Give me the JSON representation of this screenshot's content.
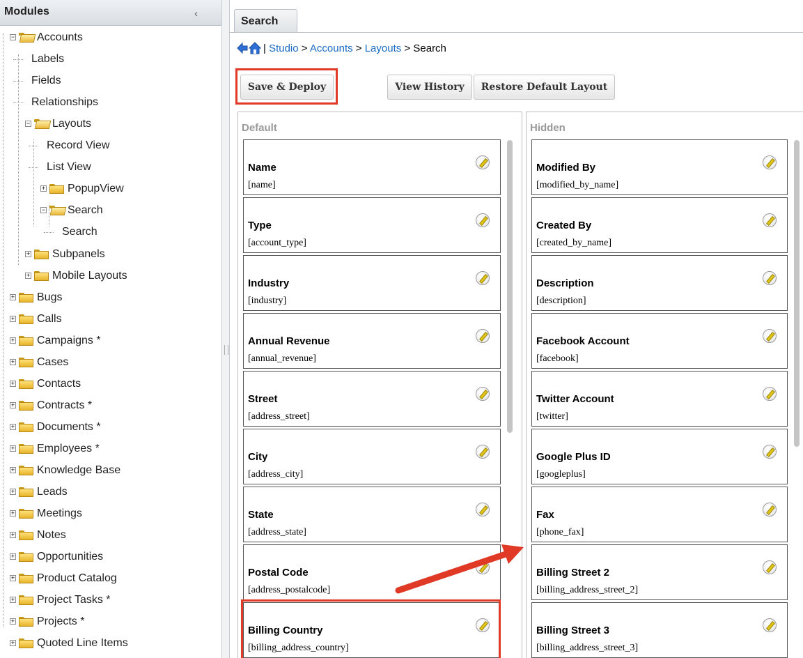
{
  "sidebar": {
    "title": "Modules",
    "collapse_icon": "chevron-left-icon",
    "tree": [
      {
        "label": "Accounts",
        "level": 0,
        "expander": "minus",
        "folder": "open"
      },
      {
        "label": "Labels",
        "level": 1,
        "expander": "none",
        "folder": "none"
      },
      {
        "label": "Fields",
        "level": 1,
        "expander": "none",
        "folder": "none"
      },
      {
        "label": "Relationships",
        "level": 1,
        "expander": "none",
        "folder": "none"
      },
      {
        "label": "Layouts",
        "level": 1,
        "expander": "minus",
        "folder": "open"
      },
      {
        "label": "Record View",
        "level": 2,
        "expander": "none",
        "folder": "none"
      },
      {
        "label": "List View",
        "level": 2,
        "expander": "none",
        "folder": "none"
      },
      {
        "label": "PopupView",
        "level": 2,
        "expander": "plus",
        "folder": "closed"
      },
      {
        "label": "Search",
        "level": 2,
        "expander": "minus",
        "folder": "open"
      },
      {
        "label": "Search",
        "level": 3,
        "expander": "none",
        "folder": "none"
      },
      {
        "label": "Subpanels",
        "level": 1,
        "expander": "plus",
        "folder": "closed"
      },
      {
        "label": "Mobile Layouts",
        "level": 1,
        "expander": "plus",
        "folder": "closed"
      },
      {
        "label": "Bugs",
        "level": 0,
        "expander": "plus",
        "folder": "closed"
      },
      {
        "label": "Calls",
        "level": 0,
        "expander": "plus",
        "folder": "closed"
      },
      {
        "label": "Campaigns *",
        "level": 0,
        "expander": "plus",
        "folder": "closed"
      },
      {
        "label": "Cases",
        "level": 0,
        "expander": "plus",
        "folder": "closed"
      },
      {
        "label": "Contacts",
        "level": 0,
        "expander": "plus",
        "folder": "closed"
      },
      {
        "label": "Contracts *",
        "level": 0,
        "expander": "plus",
        "folder": "closed"
      },
      {
        "label": "Documents *",
        "level": 0,
        "expander": "plus",
        "folder": "closed"
      },
      {
        "label": "Employees *",
        "level": 0,
        "expander": "plus",
        "folder": "closed"
      },
      {
        "label": "Knowledge Base",
        "level": 0,
        "expander": "plus",
        "folder": "closed"
      },
      {
        "label": "Leads",
        "level": 0,
        "expander": "plus",
        "folder": "closed"
      },
      {
        "label": "Meetings",
        "level": 0,
        "expander": "plus",
        "folder": "closed"
      },
      {
        "label": "Notes",
        "level": 0,
        "expander": "plus",
        "folder": "closed"
      },
      {
        "label": "Opportunities",
        "level": 0,
        "expander": "plus",
        "folder": "closed"
      },
      {
        "label": "Product Catalog",
        "level": 0,
        "expander": "plus",
        "folder": "closed"
      },
      {
        "label": "Project Tasks *",
        "level": 0,
        "expander": "plus",
        "folder": "closed"
      },
      {
        "label": "Projects *",
        "level": 0,
        "expander": "plus",
        "folder": "closed"
      },
      {
        "label": "Quoted Line Items",
        "level": 0,
        "expander": "plus",
        "folder": "closed"
      }
    ]
  },
  "main": {
    "tab_label": "Search",
    "breadcrumb": {
      "separator": "|",
      "studio": "Studio",
      "accounts": "Accounts",
      "layouts": "Layouts",
      "current": "Search",
      "arrow": ">"
    },
    "buttons": {
      "save_deploy": "Save & Deploy",
      "view_history": "View History",
      "restore_default": "Restore Default Layout"
    },
    "default_panel": {
      "title": "Default",
      "fields": [
        {
          "name": "Name",
          "key": "[name]"
        },
        {
          "name": "Type",
          "key": "[account_type]"
        },
        {
          "name": "Industry",
          "key": "[industry]"
        },
        {
          "name": "Annual Revenue",
          "key": "[annual_revenue]"
        },
        {
          "name": "Street",
          "key": "[address_street]"
        },
        {
          "name": "City",
          "key": "[address_city]"
        },
        {
          "name": "State",
          "key": "[address_state]"
        },
        {
          "name": "Postal Code",
          "key": "[address_postalcode]"
        },
        {
          "name": "Billing Country",
          "key": "[billing_address_country]"
        }
      ]
    },
    "hidden_panel": {
      "title": "Hidden",
      "fields": [
        {
          "name": "Modified By",
          "key": "[modified_by_name]"
        },
        {
          "name": "Created By",
          "key": "[created_by_name]"
        },
        {
          "name": "Description",
          "key": "[description]"
        },
        {
          "name": "Facebook Account",
          "key": "[facebook]"
        },
        {
          "name": "Twitter Account",
          "key": "[twitter]"
        },
        {
          "name": "Google Plus ID",
          "key": "[googleplus]"
        },
        {
          "name": "Fax",
          "key": "[phone_fax]"
        },
        {
          "name": "Billing Street 2",
          "key": "[billing_address_street_2]"
        },
        {
          "name": "Billing Street 3",
          "key": "[billing_address_street_3]"
        }
      ]
    }
  },
  "colors": {
    "annotation": "#e03a26",
    "link": "#1a6bc4"
  }
}
